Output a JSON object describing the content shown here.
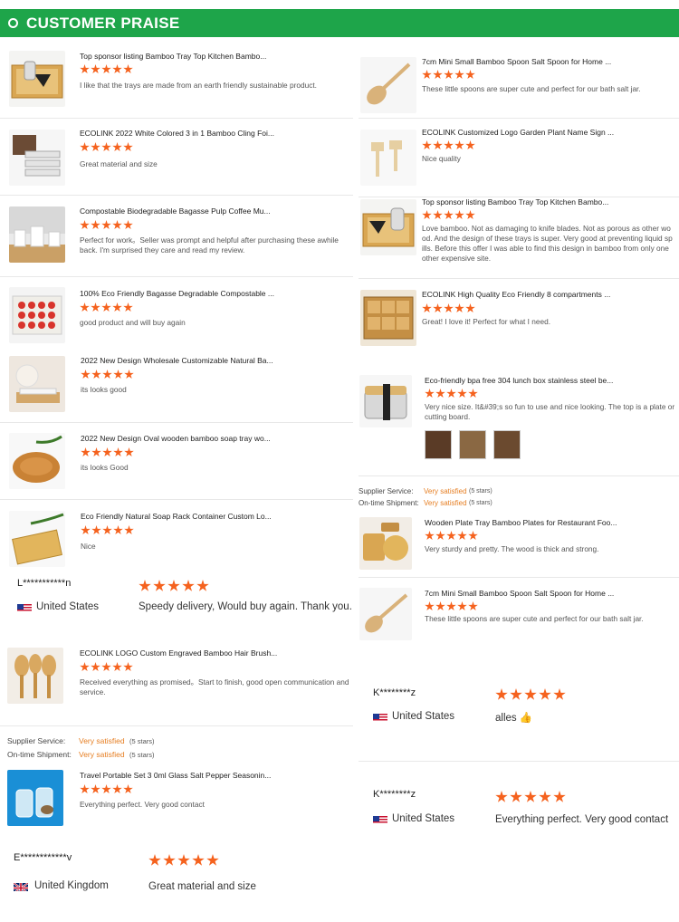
{
  "header": {
    "title": "CUSTOMER PRAISE"
  },
  "colors": {
    "accent": "#1ea54a",
    "star": "#f5621e",
    "satisfied": "#e67e22"
  },
  "left": {
    "reviews": [
      {
        "title": "Top sponsor listing Bamboo Tray Top Kitchen Bambo...",
        "comment": "I like that the trays are made from an earth friendly sustainable product.",
        "rating": 5
      },
      {
        "title": "ECOLINK 2022 White Colored 3 in 1 Bamboo Cling Foi...",
        "comment": "Great material and size",
        "rating": 5
      },
      {
        "title": "Compostable Biodegradable Bagasse Pulp Coffee Mu...",
        "comment": "Perfect for work。Seller was prompt and helpful after purchasing these awhile back. I'm surprised they care and read my review.",
        "rating": 5
      },
      {
        "title": "100% Eco Friendly Bagasse Degradable Compostable ...",
        "comment": "good product and will buy again",
        "rating": 5
      },
      {
        "title": "2022 New Design Wholesale Customizable Natural Ba...",
        "comment": "its looks good",
        "rating": 5
      },
      {
        "title": "2022 New Design Oval wooden bamboo soap tray wo...",
        "comment": "its looks Good",
        "rating": 5
      },
      {
        "title": "Eco Friendly Natural Soap Rack Container Custom Lo...",
        "comment": "Nice",
        "rating": 5
      }
    ],
    "buyer1": {
      "name": "L***********n",
      "country": "United States",
      "comment": "Speedy delivery, Would buy again. Thank you.",
      "rating": 5
    },
    "review8": {
      "title": "ECOLINK LOGO Custom Engraved Bamboo Hair Brush...",
      "comment": "Received everything as promised。Start to finish, good open communication and service.",
      "rating": 5
    },
    "meta": {
      "supplier_label": "Supplier Service:",
      "supplier_value": "Very satisfied",
      "supplier_stars": "(5 stars)",
      "shipment_label": "On-time Shipment:",
      "shipment_value": "Very satisfied",
      "shipment_stars": "(5 stars)"
    },
    "review9": {
      "title": "Travel Portable Set 3 0ml Glass Salt Pepper Seasonin...",
      "comment": "Everything perfect. Very good contact",
      "rating": 5
    },
    "buyer2": {
      "name": "E************v",
      "country": "United Kingdom",
      "comment": "Great material and size",
      "rating": 5
    }
  },
  "right": {
    "reviews": [
      {
        "title": "7cm Mini Small Bamboo Spoon Salt Spoon for Home ...",
        "comment": "These little spoons are super cute and perfect for our bath salt jar.",
        "rating": 5
      },
      {
        "title": "ECOLINK Customized Logo Garden Plant Name Sign ...",
        "comment": "Nice quality",
        "rating": 5
      },
      {
        "title": "Top sponsor listing Bamboo Tray Top Kitchen Bambo...",
        "comment": "Love bamboo. Not as damaging to knife blades. Not as porous as other wood. And the design of these trays is super. Very good at preventing liquid spills. Before this offer I was able to find this design in bamboo from only one other expensive site.",
        "rating": 5
      },
      {
        "title": "ECOLINK High Quality Eco Friendly 8 compartments ...",
        "comment": "Great! I love it! Perfect for what I need.",
        "rating": 5
      },
      {
        "title": "Eco-friendly bpa free 304 lunch box stainless steel be...",
        "comment": "Very nice size. It&#39;s so fun to use and nice looking. The top is a plate or cutting board.",
        "rating": 5
      }
    ],
    "meta": {
      "supplier_label": "Supplier Service:",
      "supplier_value": "Very satisfied",
      "supplier_stars": "(5 stars)",
      "shipment_label": "On-time Shipment:",
      "shipment_value": "Very satisfied",
      "shipment_stars": "(5 stars)"
    },
    "review6": {
      "title": "Wooden Plate Tray Bamboo Plates for Restaurant Foo...",
      "comment": "Very sturdy and pretty. The wood is thick and strong.",
      "rating": 5
    },
    "review7": {
      "title": "7cm Mini Small Bamboo Spoon Salt Spoon for Home ...",
      "comment": "These little spoons are super cute and perfect for our bath salt jar.",
      "rating": 5
    },
    "buyer1": {
      "name": "K********z",
      "country": "United States",
      "comment": "alles 👍",
      "rating": 5
    },
    "buyer2": {
      "name": "K********z",
      "country": "United States",
      "comment": "Everything perfect. Very good contact",
      "rating": 5
    }
  }
}
